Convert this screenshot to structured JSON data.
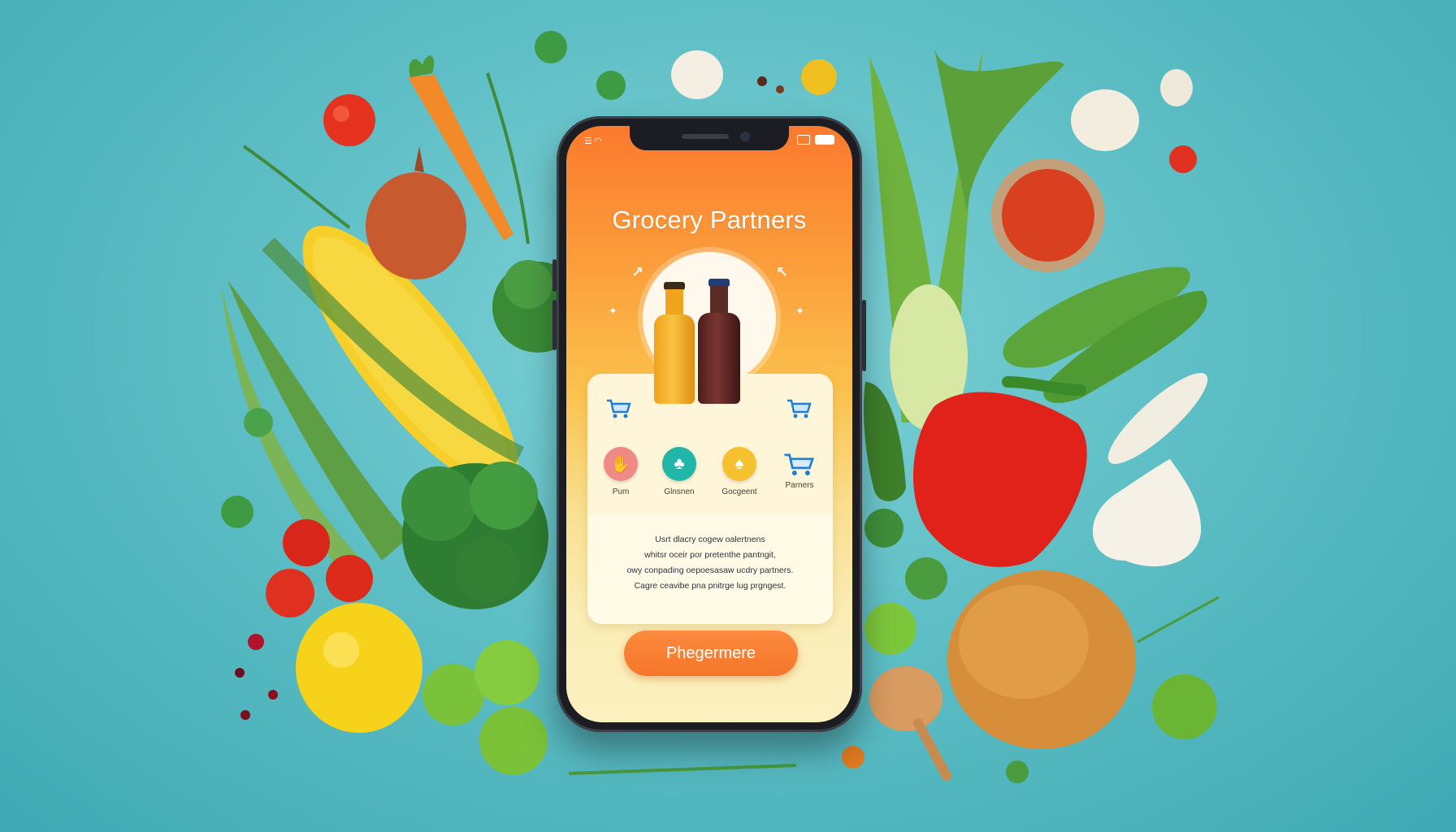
{
  "app": {
    "title": "Grocery Partners",
    "status_left": "☰ ◠",
    "categories": [
      {
        "label": "Pum",
        "color": "#ef8a86",
        "glyph": "✋"
      },
      {
        "label": "Glnsnen",
        "color": "#21b7a8",
        "glyph": "♣"
      },
      {
        "label": "Gocgeent",
        "color": "#f5c12f",
        "glyph": "♠"
      },
      {
        "label": "Parners",
        "color": "#ffffff",
        "glyph": "cart"
      }
    ],
    "description": [
      "Usrt dlacry cogew oalertnens",
      "whitsr oceir por pretenthe pantngit,",
      "owy conpading oepoesasaw ucdry partners.",
      "Cagre ceavibe pna pnitrge lug prgngest."
    ],
    "cta_label": "Phegermere"
  },
  "colors": {
    "accent": "#f6762a",
    "background": "#5fbfc6",
    "cart_blue": "#1e7fd6"
  },
  "icons": [
    "cart-icon",
    "bottle-icon",
    "sparkle-icon",
    "signal-icon",
    "battery-icon"
  ]
}
